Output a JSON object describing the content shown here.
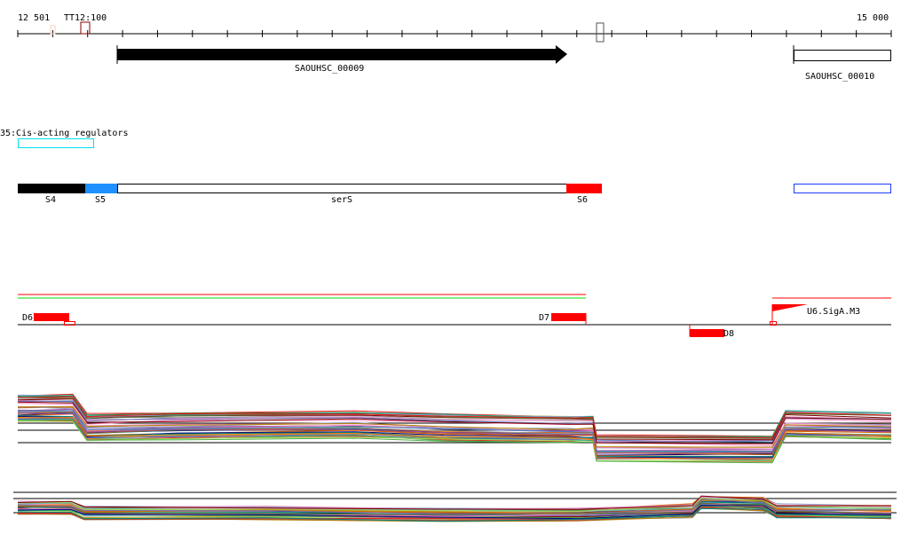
{
  "ruler": {
    "start_label": "12 501",
    "end_label": "15 000",
    "marker_label": "TT12:100"
  },
  "genes": [
    {
      "name": "SAOUHSC_00009",
      "strand": "forward"
    },
    {
      "name": "SAOUHSC_00010",
      "strand": "unknown"
    }
  ],
  "regulators_track": {
    "label": "35:Cis-acting regulators"
  },
  "segments": [
    {
      "label": "S4",
      "color": "#000000"
    },
    {
      "label": "S5",
      "color": "#1e90ff"
    },
    {
      "label": "serS",
      "color": "#ffffff"
    },
    {
      "label": "S6",
      "color": "#ff0000"
    }
  ],
  "features": [
    {
      "label": "D6"
    },
    {
      "label": "D7"
    },
    {
      "label": "D8"
    },
    {
      "label": "U6.SigA.M3"
    }
  ],
  "colors": {
    "accent_red": "#ff0000",
    "green": "#00dd00",
    "cyan": "#00e5ee",
    "blue": "#1e90ff"
  },
  "profile_colors": [
    "#e41a1c",
    "#377eb8",
    "#4daf4a",
    "#984ea3",
    "#ff7f00",
    "#a65628",
    "#f781bf",
    "#999999",
    "#66c2a5",
    "#8da0cb",
    "#e78ac3",
    "#a6d854",
    "#b8860b",
    "#1b9e77",
    "#d95f02",
    "#7570b3",
    "#000080",
    "#008080",
    "#800000",
    "#556b2f"
  ]
}
